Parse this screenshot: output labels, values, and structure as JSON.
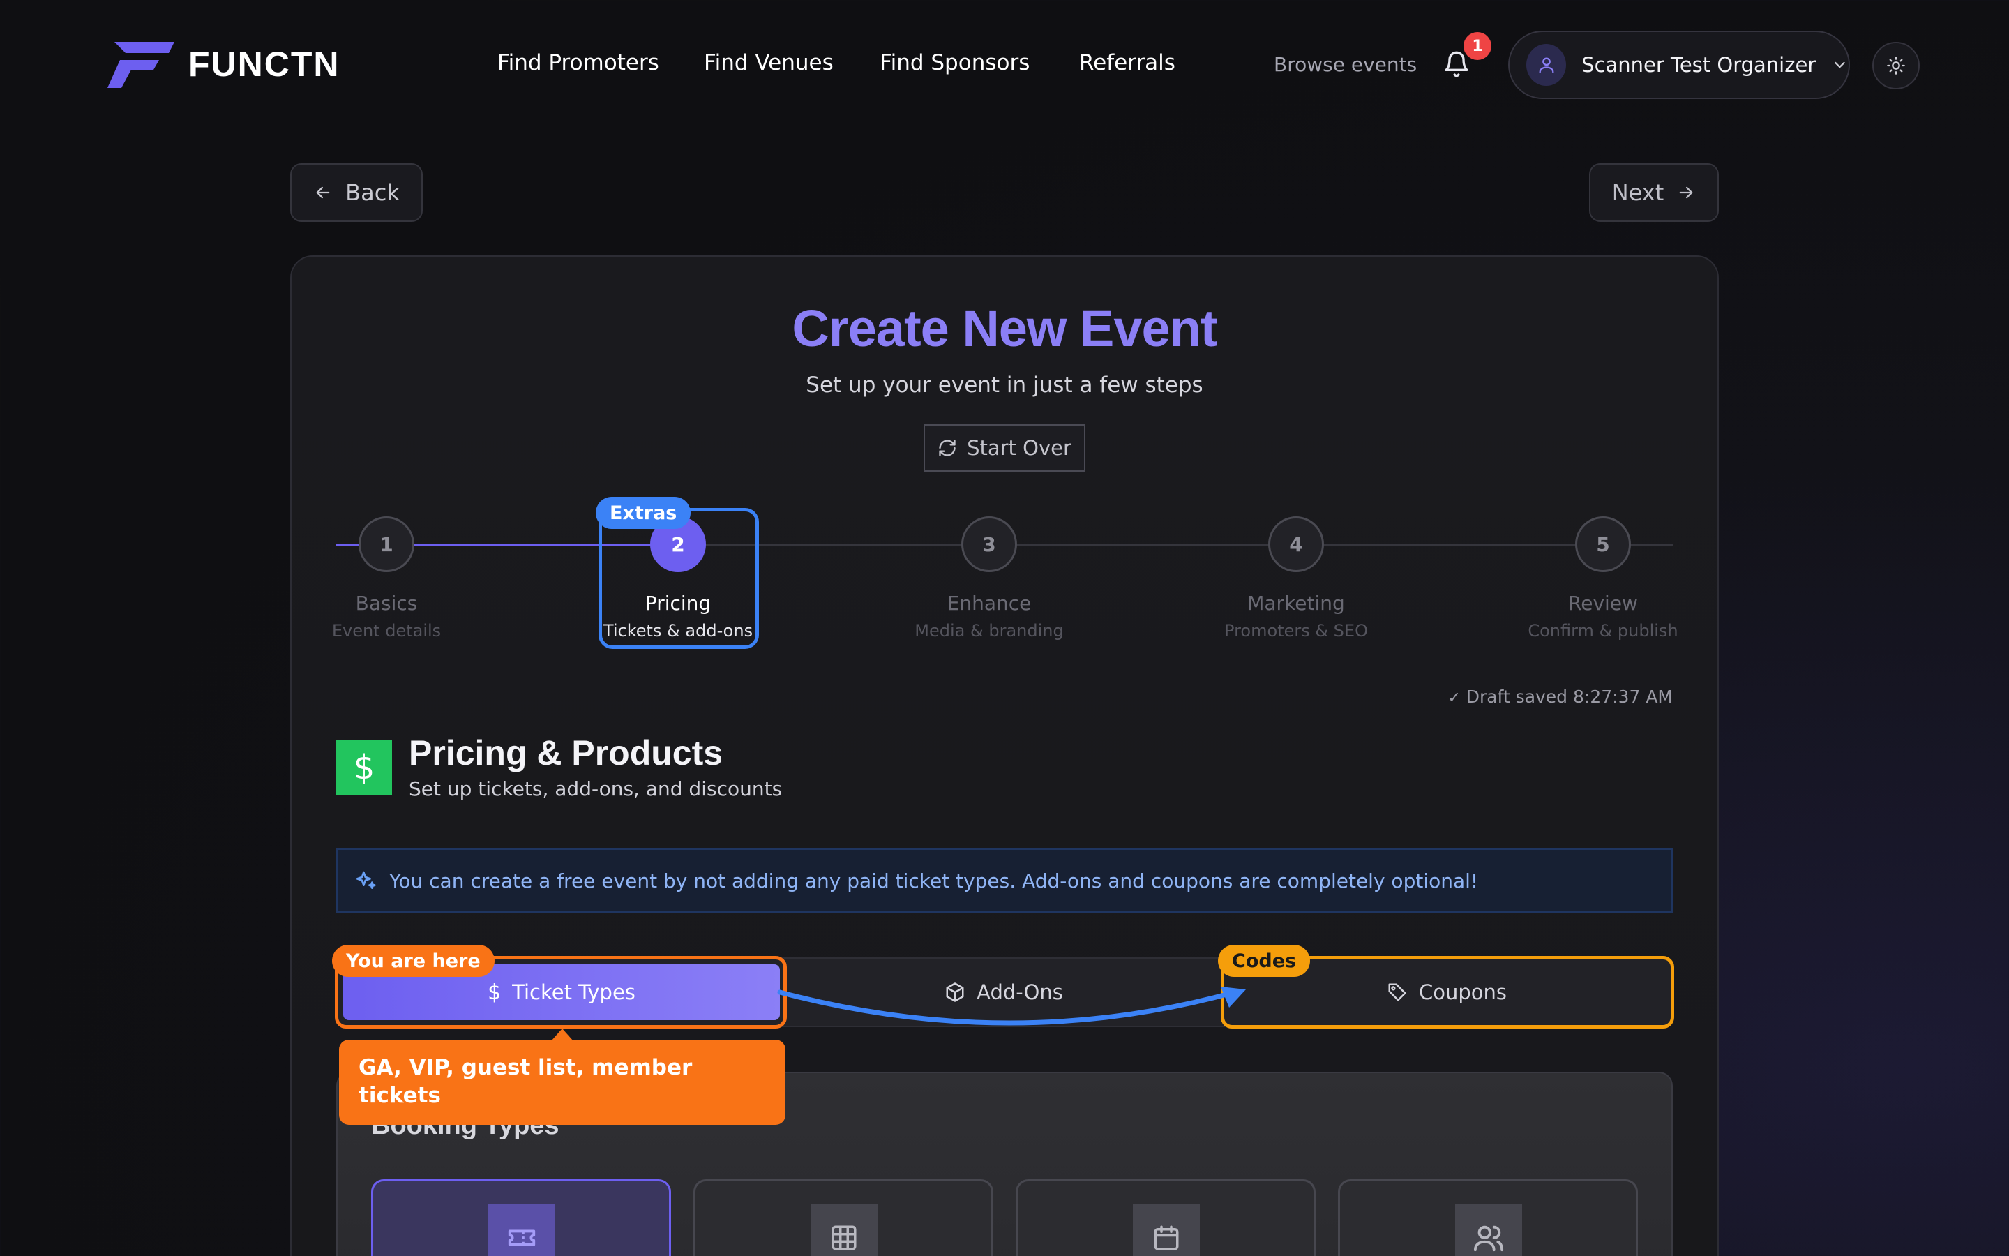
{
  "header": {
    "brand": "FUNCTN",
    "nav": [
      "Find Promoters",
      "Find Venues",
      "Find Sponsors",
      "Referrals"
    ],
    "browse": "Browse events",
    "notifications_count": "1",
    "user_name": "Scanner Test Organizer"
  },
  "toolbar": {
    "back": "Back",
    "next": "Next"
  },
  "page": {
    "title": "Create New Event",
    "subtitle": "Set up your event in just a few steps",
    "start_over": "Start Over"
  },
  "stepper": {
    "steps": [
      {
        "num": "1",
        "label": "Basics",
        "sub": "Event details"
      },
      {
        "num": "2",
        "label": "Pricing",
        "sub": "Tickets & add-ons"
      },
      {
        "num": "3",
        "label": "Enhance",
        "sub": "Media & branding"
      },
      {
        "num": "4",
        "label": "Marketing",
        "sub": "Promoters & SEO"
      },
      {
        "num": "5",
        "label": "Review",
        "sub": "Confirm & publish"
      }
    ],
    "active_step": 2,
    "extras_tag": "Extras",
    "draft_saved": "Draft saved 8:27:37 AM"
  },
  "section": {
    "icon": "$",
    "title": "Pricing & Products",
    "subtitle": "Set up tickets, add-ons, and discounts",
    "info": "You can create a free event by not adding any paid ticket types. Add-ons and coupons are completely optional!"
  },
  "tabs": {
    "items": [
      "Ticket Types",
      "Add-Ons",
      "Coupons"
    ],
    "active": "Ticket Types",
    "you_are_here": "You are here",
    "codes_tag": "Codes",
    "tooltip": "GA, VIP, guest list, member tickets"
  },
  "booking": {
    "title": "Booking Types",
    "icons": [
      "ticket-icon",
      "grid-icon",
      "calendar-icon",
      "users-icon"
    ]
  },
  "colors": {
    "accent": "#6d5ff0",
    "title": "#8b7ff6",
    "success": "#22c55e",
    "highlight_blue": "#3b82f6",
    "highlight_orange": "#f97316",
    "highlight_yellow": "#f59e0b",
    "badge_red": "#ef4444"
  }
}
